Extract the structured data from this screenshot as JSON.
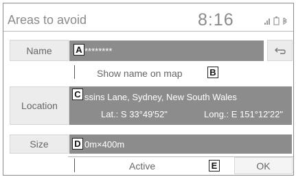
{
  "header": {
    "title": "Areas to avoid",
    "clock": "8:16"
  },
  "name": {
    "label": "Name",
    "value": "********",
    "callout": "A"
  },
  "show_name": {
    "label": "Show name on map",
    "callout": "B"
  },
  "location": {
    "label": "Location",
    "address": "ssins Lane, Sydney, New South Wales",
    "lat": "Lat.: S 33°49'52\"",
    "long": "Long.: E 151°12'22\"",
    "callout": "C"
  },
  "size": {
    "label": "Size",
    "value": "0m×400m",
    "callout": "D"
  },
  "footer": {
    "active_label": "Active",
    "ok_label": "OK",
    "callout": "E"
  },
  "icons": {
    "back": "back-arrow-icon",
    "signal": "signal-icon",
    "battery": "battery-icon",
    "bluetooth": "bluetooth-icon"
  }
}
